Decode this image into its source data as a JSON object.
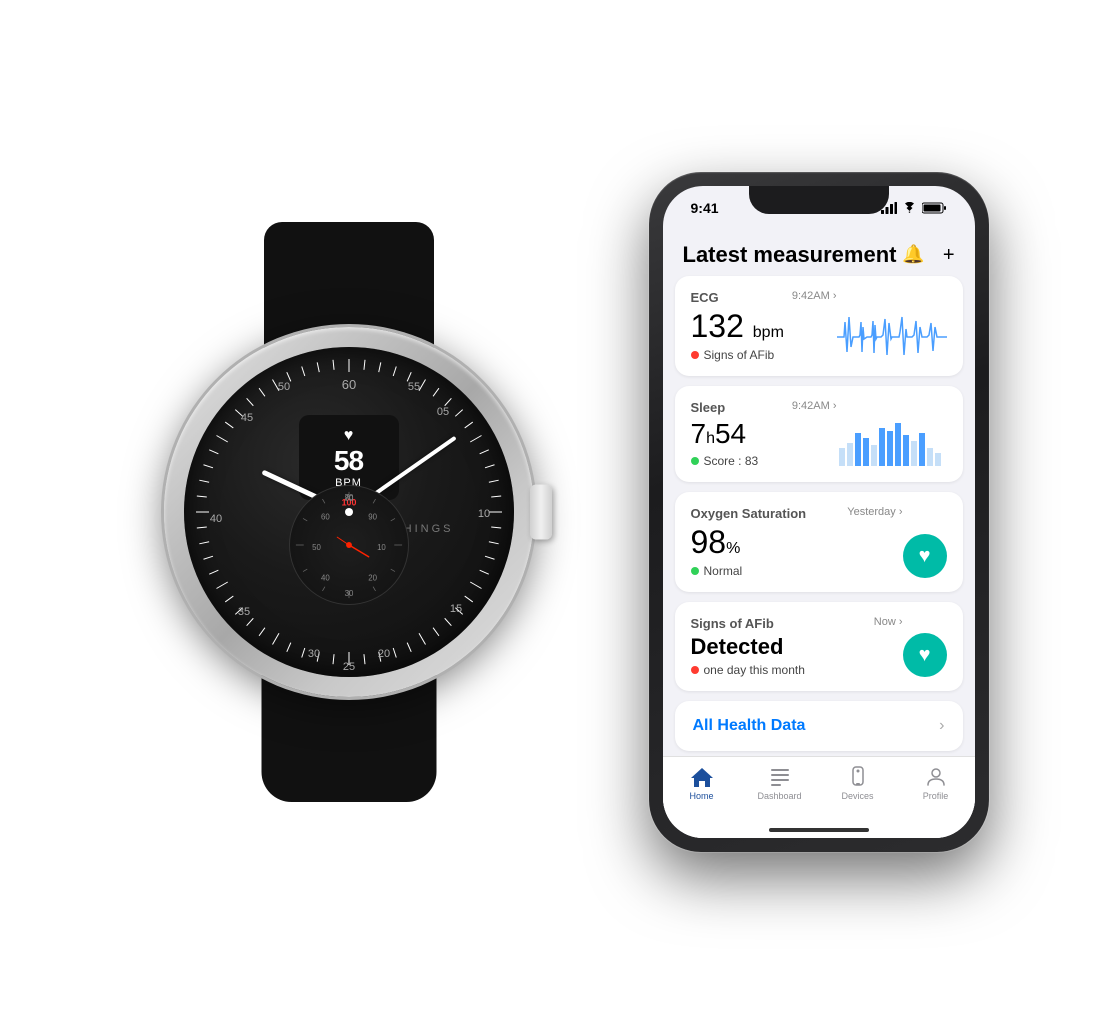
{
  "watch": {
    "brand": "WITHINGS",
    "bpm": "58",
    "bpm_unit": "BPM",
    "heart_icon": "♥"
  },
  "phone": {
    "status_bar": {
      "time": "9:41",
      "signal": "●●●●",
      "wifi": "WiFi",
      "battery": "Battery"
    },
    "header": {
      "title": "Latest measurement",
      "bell_icon": "🔔",
      "plus_icon": "+"
    },
    "cards": [
      {
        "id": "ecg",
        "title": "ECG",
        "time": "9:42AM",
        "value": "132",
        "unit": " bpm",
        "status_color": "red",
        "status_text": "Signs of AFib",
        "has_chart": true,
        "chart_type": "ecg"
      },
      {
        "id": "sleep",
        "title": "Sleep",
        "time": "9:42AM",
        "value": "7h54",
        "unit": "",
        "status_color": "green",
        "status_text": "Score : 83",
        "has_chart": true,
        "chart_type": "sleep"
      },
      {
        "id": "oxygen",
        "title": "Oxygen Saturation",
        "time": "Yesterday",
        "value": "98",
        "unit": "%",
        "status_color": "green",
        "status_text": "Normal",
        "has_chart": false,
        "has_icon": true
      },
      {
        "id": "afib",
        "title": "Signs of AFib",
        "title2": "Detected",
        "time": "Now",
        "status_color": "red",
        "status_text": "one day this month",
        "has_chart": false,
        "has_icon": true
      }
    ],
    "all_health_data": "All Health Data",
    "tab_bar": [
      {
        "id": "home",
        "label": "Home",
        "icon": "⌂",
        "active": true
      },
      {
        "id": "dashboard",
        "label": "Dashboard",
        "icon": "☰",
        "active": false
      },
      {
        "id": "devices",
        "label": "Devices",
        "icon": "⌚",
        "active": false
      },
      {
        "id": "profile",
        "label": "Profile",
        "icon": "👤",
        "active": false
      }
    ]
  }
}
